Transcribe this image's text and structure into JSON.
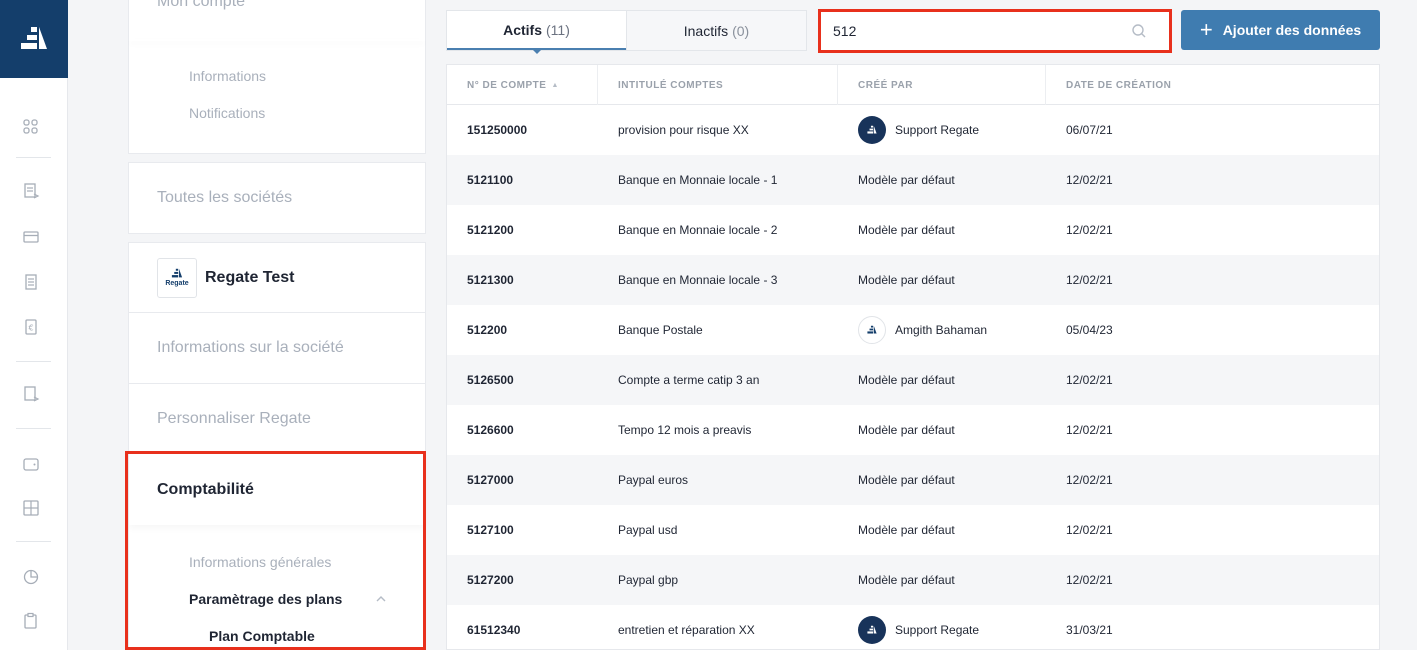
{
  "settings": {
    "account_title": "Mon compte",
    "account_items": [
      "Informations",
      "Notifications"
    ],
    "all_companies": "Toutes les sociétés",
    "company_name": "Regate Test",
    "company_logo_text": "Regate",
    "company_info": "Informations sur la société",
    "customize": "Personnaliser Regate",
    "accounting": "Comptabilité",
    "accounting_items": {
      "general": "Informations générales",
      "plans": "Paramètrage des plans",
      "chart_of_accounts": "Plan Comptable"
    }
  },
  "tabs": {
    "active_label": "Actifs",
    "active_count": "(11)",
    "inactive_label": "Inactifs",
    "inactive_count": "(0)"
  },
  "search": {
    "value": "512"
  },
  "add_button": {
    "label": "Ajouter des données"
  },
  "table": {
    "headers": {
      "account_number": "N° DE COMPTE",
      "account_label": "INTITULÉ COMPTES",
      "created_by": "CRÉÉ PAR",
      "created_date": "DATE DE CRÉATION"
    },
    "rows": [
      {
        "num": "151250000",
        "label": "provision pour risque XX",
        "by": "Support Regate",
        "avatar": "dark",
        "date": "06/07/21"
      },
      {
        "num": "5121100",
        "label": "Banque en Monnaie locale - 1",
        "by": "Modèle par défaut",
        "avatar": "none",
        "date": "12/02/21"
      },
      {
        "num": "5121200",
        "label": "Banque en Monnaie locale - 2",
        "by": "Modèle par défaut",
        "avatar": "none",
        "date": "12/02/21"
      },
      {
        "num": "5121300",
        "label": "Banque en Monnaie locale - 3",
        "by": "Modèle par défaut",
        "avatar": "none",
        "date": "12/02/21"
      },
      {
        "num": "512200",
        "label": "Banque Postale",
        "by": "Amgith Bahaman",
        "avatar": "light",
        "date": "05/04/23"
      },
      {
        "num": "5126500",
        "label": "Compte a terme catip 3 an",
        "by": "Modèle par défaut",
        "avatar": "none",
        "date": "12/02/21"
      },
      {
        "num": "5126600",
        "label": "Tempo 12 mois a preavis",
        "by": "Modèle par défaut",
        "avatar": "none",
        "date": "12/02/21"
      },
      {
        "num": "5127000",
        "label": "Paypal euros",
        "by": "Modèle par défaut",
        "avatar": "none",
        "date": "12/02/21"
      },
      {
        "num": "5127100",
        "label": "Paypal usd",
        "by": "Modèle par défaut",
        "avatar": "none",
        "date": "12/02/21"
      },
      {
        "num": "5127200",
        "label": "Paypal gbp",
        "by": "Modèle par défaut",
        "avatar": "none",
        "date": "12/02/21"
      },
      {
        "num": "61512340",
        "label": "entretien et réparation XX",
        "by": "Support Regate",
        "avatar": "dark",
        "date": "31/03/21"
      }
    ]
  },
  "colors": {
    "brand": "#143e6b",
    "accent": "#3f7cb0",
    "highlight": "#e8301c"
  },
  "icons": {
    "rail": [
      "dashboard-icon",
      "invoice-icon",
      "card-icon",
      "document-icon",
      "euro-icon",
      "receipt-icon",
      "wallet-icon",
      "grid-icon",
      "chart-icon",
      "clipboard-icon"
    ]
  }
}
